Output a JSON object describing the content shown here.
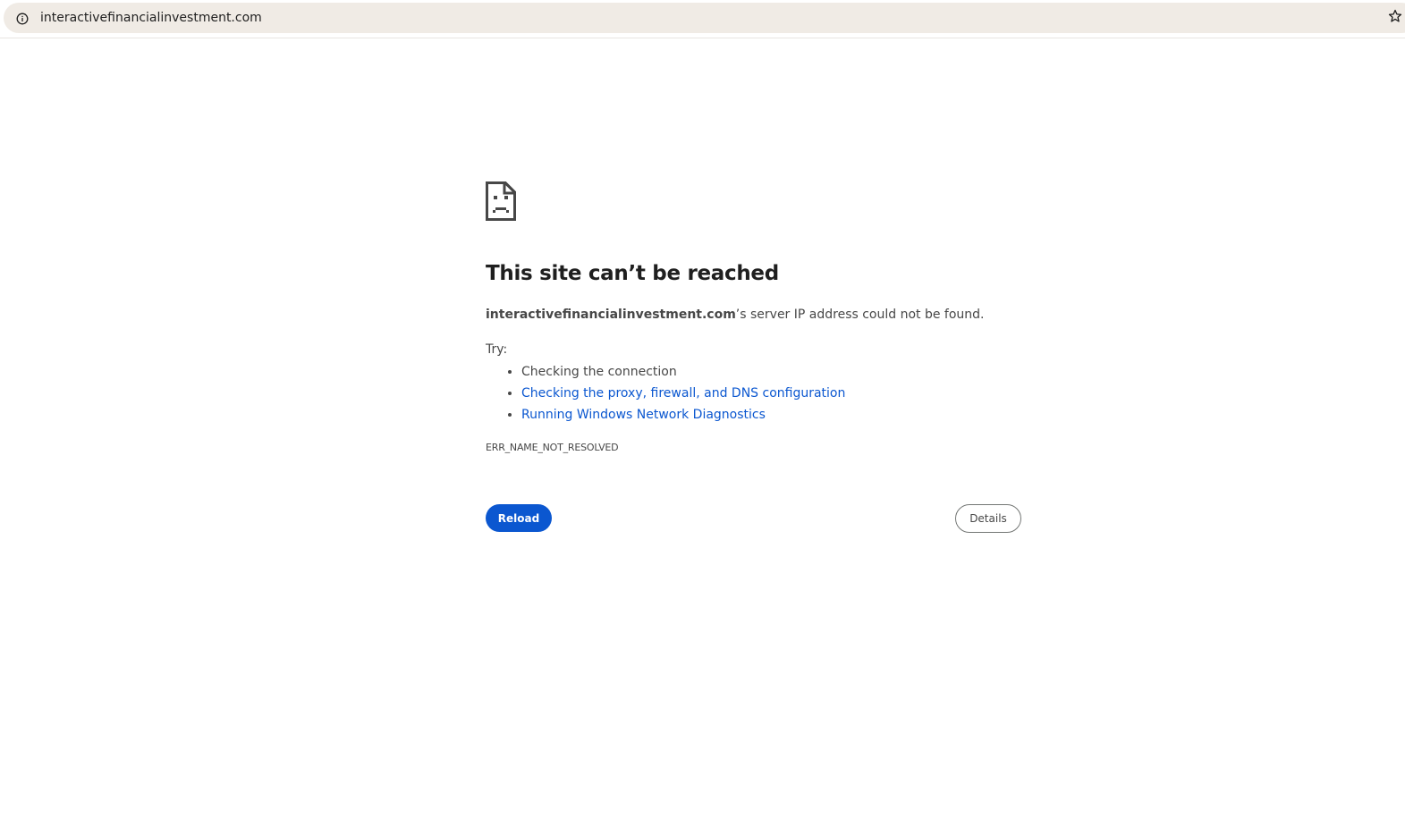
{
  "browser": {
    "url": "interactivefinancialinvestment.com",
    "info_icon": "info-icon",
    "bookmark_icon": "star-icon"
  },
  "error_page": {
    "icon": "sad-document-icon",
    "title": "This site can’t be reached",
    "summary_host": "interactivefinancialinvestment.com",
    "summary_rest": "’s server IP address could not be found.",
    "try_label": "Try:",
    "suggestions": [
      {
        "text": "Checking the connection",
        "is_link": false
      },
      {
        "text": "Checking the proxy, firewall, and DNS configuration",
        "is_link": true
      },
      {
        "text": "Running Windows Network Diagnostics",
        "is_link": true
      }
    ],
    "error_code": "ERR_NAME_NOT_RESOLVED",
    "reload_label": "Reload",
    "details_label": "Details"
  },
  "colors": {
    "accent": "#0b57d0",
    "text": "#474747",
    "title": "#1f1f1f",
    "omnibox_bg": "#f0ebe5"
  }
}
